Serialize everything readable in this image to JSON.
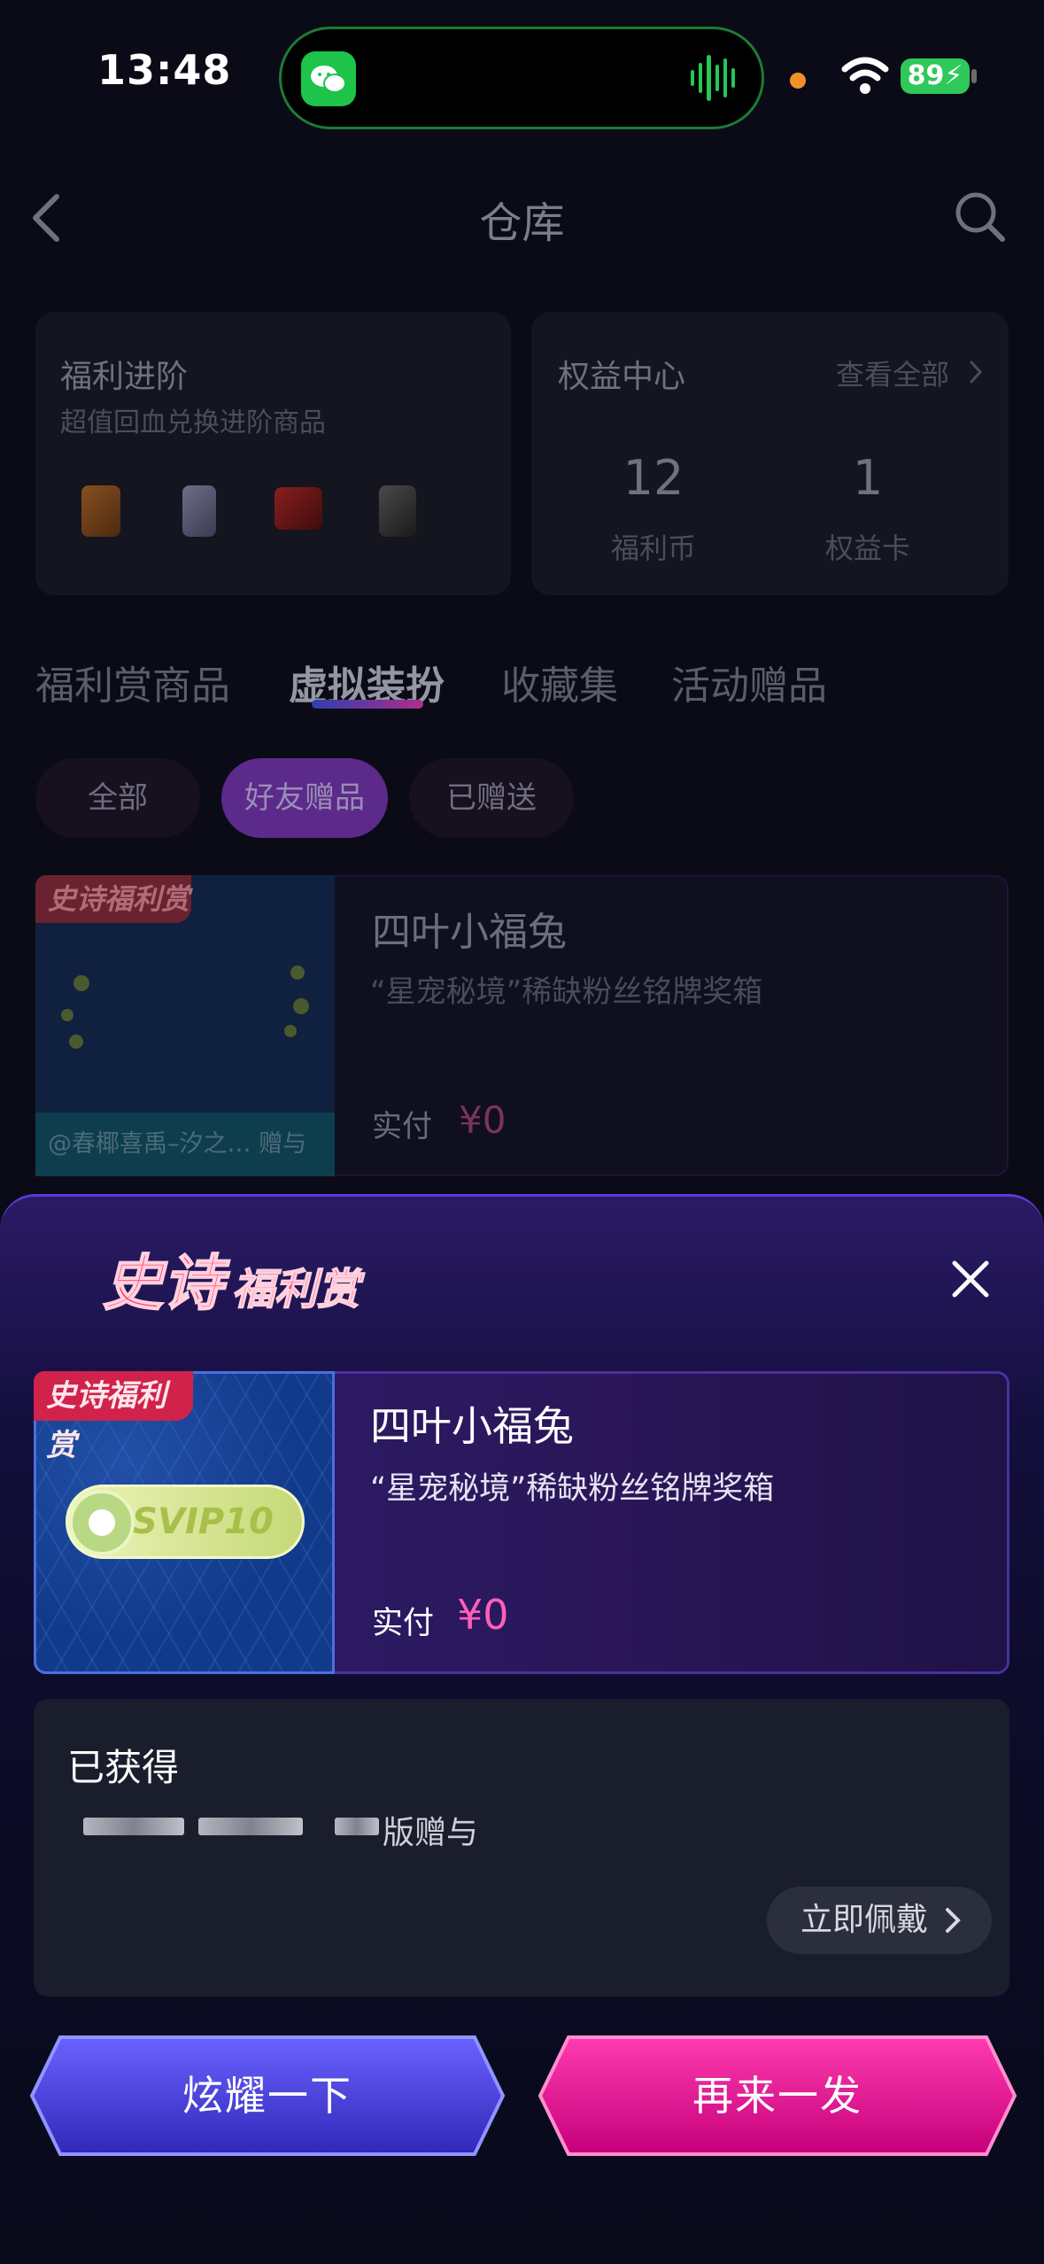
{
  "status_bar": {
    "time": "13:48",
    "battery": "89"
  },
  "header": {
    "title": "仓库"
  },
  "welfare_card": {
    "title": "福利进阶",
    "subtitle": "超值回血兑换进阶商品"
  },
  "rights_card": {
    "title": "权益中心",
    "view_all": "查看全部",
    "stats": [
      {
        "value": "12",
        "label": "福利币"
      },
      {
        "value": "1",
        "label": "权益卡"
      }
    ]
  },
  "tabs": [
    "福利赏商品",
    "虚拟装扮",
    "收藏集",
    "活动赠品"
  ],
  "active_tab": 1,
  "filters": [
    "全部",
    "好友赠品",
    "已赠送"
  ],
  "active_filter": 1,
  "background_item": {
    "badge": "史诗福利赏",
    "caption": "@春椰喜禹–汐之… 赠与",
    "name": "四叶小福兔",
    "desc": "“星宠秘境”稀缺粉丝铭牌奖箱",
    "paid_label": "实付",
    "price": "¥0"
  },
  "modal": {
    "logo_text": "史诗福利赏",
    "item": {
      "badge": "史诗福利赏",
      "svip_text": "SVIP10",
      "name": "四叶小福兔",
      "desc": "“星宠秘境”稀缺粉丝铭牌奖箱",
      "paid_label": "实付",
      "price": "¥0"
    },
    "obtained": {
      "title": "已获得",
      "giver_suffix": "版赠与",
      "wear_button": "立即佩戴"
    },
    "show_off_button": "炫耀一下",
    "again_button": "再来一发"
  },
  "colors": {
    "accent_pink": "#ff5fb8",
    "button_blue": "#4d44e0",
    "button_magenta": "#e0188f"
  }
}
